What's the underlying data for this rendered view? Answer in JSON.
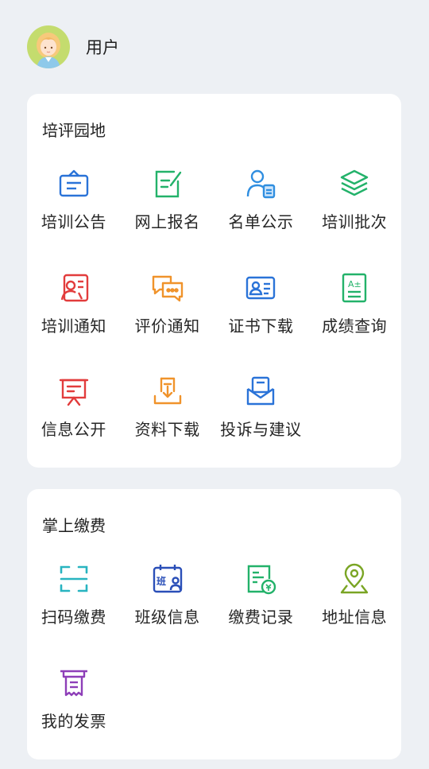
{
  "user": {
    "name": "用户"
  },
  "section1": {
    "title": "培评园地",
    "items": [
      {
        "label": "培训公告",
        "icon": "notice-board-icon",
        "color": "#2a73d8"
      },
      {
        "label": "网上报名",
        "icon": "edit-form-icon",
        "color": "#23b26a"
      },
      {
        "label": "名单公示",
        "icon": "person-list-icon",
        "color": "#2f8ee0"
      },
      {
        "label": "培训批次",
        "icon": "layers-icon",
        "color": "#23b26a"
      },
      {
        "label": "培训通知",
        "icon": "notification-person-icon",
        "color": "#e23c3c"
      },
      {
        "label": "评价通知",
        "icon": "chat-bubbles-icon",
        "color": "#f0932b"
      },
      {
        "label": "证书下载",
        "icon": "id-card-icon",
        "color": "#2a73d8"
      },
      {
        "label": "成绩查询",
        "icon": "grade-sheet-icon",
        "color": "#23b26a"
      },
      {
        "label": "信息公开",
        "icon": "presentation-board-icon",
        "color": "#e23c3c"
      },
      {
        "label": "资料下载",
        "icon": "download-tray-icon",
        "color": "#f0932b"
      },
      {
        "label": "投诉与建议",
        "icon": "envelope-icon",
        "color": "#2a73d8"
      }
    ]
  },
  "section2": {
    "title": "掌上缴费",
    "items": [
      {
        "label": "扫码缴费",
        "icon": "scan-icon",
        "color": "#28b4c0"
      },
      {
        "label": "班级信息",
        "icon": "class-calendar-icon",
        "color": "#2a4fb8",
        "badge": "班"
      },
      {
        "label": "缴费记录",
        "icon": "payment-record-icon",
        "color": "#23b26a"
      },
      {
        "label": "地址信息",
        "icon": "location-pin-icon",
        "color": "#7aa524"
      },
      {
        "label": "我的发票",
        "icon": "invoice-icon",
        "color": "#8e3fb8"
      }
    ]
  }
}
